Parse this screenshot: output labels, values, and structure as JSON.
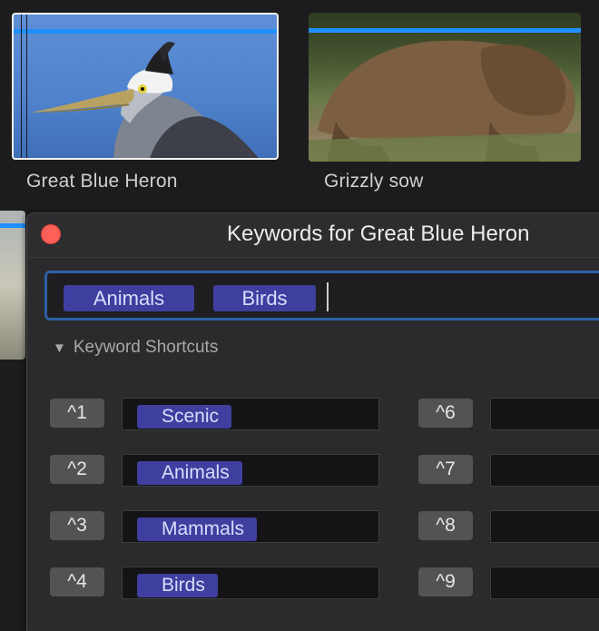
{
  "clips": [
    {
      "title": "Great Blue Heron"
    },
    {
      "title": "Grizzly sow"
    }
  ],
  "panel": {
    "title": "Keywords for Great Blue Heron",
    "keywords": [
      "Animals",
      "Birds"
    ],
    "shortcuts_label": "Keyword Shortcuts",
    "shortcuts_left": [
      {
        "key": "^1",
        "keyword": "Scenic"
      },
      {
        "key": "^2",
        "keyword": "Animals"
      },
      {
        "key": "^3",
        "keyword": "Mammals"
      },
      {
        "key": "^4",
        "keyword": "Birds"
      }
    ],
    "shortcuts_right": [
      {
        "key": "^6",
        "keyword": ""
      },
      {
        "key": "^7",
        "keyword": ""
      },
      {
        "key": "^8",
        "keyword": ""
      },
      {
        "key": "^9",
        "keyword": ""
      }
    ]
  },
  "colors": {
    "accent_blue": "#1e8fff",
    "token_purple": "#3f3fa0",
    "close_red": "#fe5f57",
    "focus_ring": "#2f5fa6"
  },
  "icons": {
    "close": "close-icon",
    "disclosure": "disclosure-triangle-icon"
  }
}
